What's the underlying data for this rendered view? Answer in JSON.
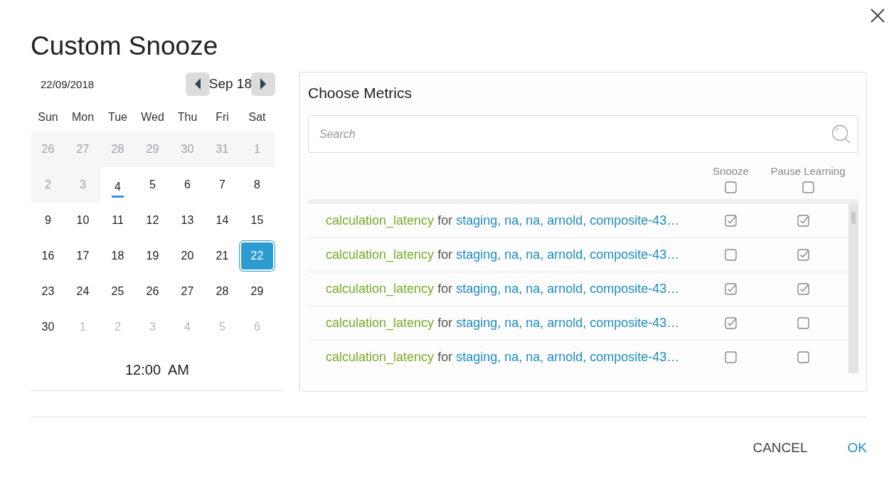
{
  "dialog": {
    "title": "Custom Snooze"
  },
  "calendar": {
    "date": "22/09/2018",
    "month": "Sep 18",
    "weekdays": [
      "Sun",
      "Mon",
      "Tue",
      "Wed",
      "Thu",
      "Fri",
      "Sat"
    ],
    "weeks": [
      [
        {
          "label": "26",
          "disabled": true,
          "today": false,
          "selected": false
        },
        {
          "label": "27",
          "disabled": true,
          "today": false,
          "selected": false
        },
        {
          "label": "28",
          "disabled": true,
          "today": false,
          "selected": false
        },
        {
          "label": "29",
          "disabled": true,
          "today": false,
          "selected": false
        },
        {
          "label": "30",
          "disabled": true,
          "today": false,
          "selected": false
        },
        {
          "label": "31",
          "disabled": true,
          "today": false,
          "selected": false
        },
        {
          "label": "1",
          "disabled": true,
          "today": false,
          "selected": false
        }
      ],
      [
        {
          "label": "2",
          "disabled": true,
          "today": false,
          "selected": false
        },
        {
          "label": "3",
          "disabled": true,
          "today": false,
          "selected": false
        },
        {
          "label": "4",
          "outside": false,
          "disabled": false,
          "today": true,
          "selected": false
        },
        {
          "label": "5",
          "outside": false,
          "disabled": false,
          "today": false,
          "selected": false
        },
        {
          "label": "6",
          "outside": false,
          "disabled": false,
          "today": false,
          "selected": false
        },
        {
          "label": "7",
          "outside": false,
          "disabled": false,
          "today": false,
          "selected": false
        },
        {
          "label": "8",
          "outside": false,
          "disabled": false,
          "today": false,
          "selected": false
        }
      ],
      [
        {
          "label": "9",
          "outside": false,
          "disabled": false,
          "today": false,
          "selected": false
        },
        {
          "label": "10",
          "outside": false,
          "disabled": false,
          "today": false,
          "selected": false
        },
        {
          "label": "11",
          "outside": false,
          "disabled": false,
          "today": false,
          "selected": false
        },
        {
          "label": "12",
          "outside": false,
          "disabled": false,
          "today": false,
          "selected": false
        },
        {
          "label": "13",
          "outside": false,
          "disabled": false,
          "today": false,
          "selected": false
        },
        {
          "label": "14",
          "outside": false,
          "disabled": false,
          "today": false,
          "selected": false
        },
        {
          "label": "15",
          "outside": false,
          "disabled": false,
          "today": false,
          "selected": false
        }
      ],
      [
        {
          "label": "16",
          "outside": false,
          "disabled": false,
          "today": false,
          "selected": false
        },
        {
          "label": "17",
          "outside": false,
          "disabled": false,
          "today": false,
          "selected": false
        },
        {
          "label": "18",
          "outside": false,
          "disabled": false,
          "today": false,
          "selected": false
        },
        {
          "label": "19",
          "outside": false,
          "disabled": false,
          "today": false,
          "selected": false
        },
        {
          "label": "20",
          "outside": false,
          "disabled": false,
          "today": false,
          "selected": false
        },
        {
          "label": "21",
          "outside": false,
          "disabled": false,
          "today": false,
          "selected": false
        },
        {
          "label": "22",
          "outside": false,
          "disabled": false,
          "today": false,
          "selected": true
        }
      ],
      [
        {
          "label": "23",
          "outside": false,
          "disabled": false,
          "today": false,
          "selected": false
        },
        {
          "label": "24",
          "outside": false,
          "disabled": false,
          "today": false,
          "selected": false
        },
        {
          "label": "25",
          "outside": false,
          "disabled": false,
          "today": false,
          "selected": false
        },
        {
          "label": "26",
          "outside": false,
          "disabled": false,
          "today": false,
          "selected": false
        },
        {
          "label": "27",
          "outside": false,
          "disabled": false,
          "today": false,
          "selected": false
        },
        {
          "label": "28",
          "outside": false,
          "disabled": false,
          "today": false,
          "selected": false
        },
        {
          "label": "29",
          "outside": false,
          "disabled": false,
          "today": false,
          "selected": false
        }
      ],
      [
        {
          "label": "30",
          "outside": false,
          "disabled": false,
          "today": false,
          "selected": false
        },
        {
          "label": "1",
          "outside": true,
          "disabled": false,
          "today": false,
          "selected": false
        },
        {
          "label": "2",
          "outside": true,
          "disabled": false,
          "today": false,
          "selected": false
        },
        {
          "label": "3",
          "outside": true,
          "disabled": false,
          "today": false,
          "selected": false
        },
        {
          "label": "4",
          "outside": true,
          "disabled": false,
          "today": false,
          "selected": false
        },
        {
          "label": "5",
          "outside": true,
          "disabled": false,
          "today": false,
          "selected": false
        },
        {
          "label": "6",
          "outside": true,
          "disabled": false,
          "today": false,
          "selected": false
        }
      ]
    ],
    "time": "12:00  AM"
  },
  "metrics": {
    "title": "Choose Metrics",
    "search": {
      "placeholder": "Search"
    },
    "columns": [
      {
        "label": "Snooze",
        "checked": false
      },
      {
        "label": "Pause Learning",
        "checked": false
      }
    ],
    "rows": [
      {
        "metric": "calculation_latency",
        "joiner": "for",
        "target": "staging, na, na, arnold, composite-43…",
        "snooze": true,
        "pause": true
      },
      {
        "metric": "calculation_latency",
        "joiner": "for",
        "target": "staging, na, na, arnold, composite-43…",
        "snooze": false,
        "pause": true
      },
      {
        "metric": "calculation_latency",
        "joiner": "for",
        "target": "staging, na, na, arnold, composite-43…",
        "snooze": true,
        "pause": true
      },
      {
        "metric": "calculation_latency",
        "joiner": "for",
        "target": "staging, na, na, arnold, composite-43…",
        "snooze": true,
        "pause": false
      },
      {
        "metric": "calculation_latency",
        "joiner": "for",
        "target": "staging, na, na, arnold, composite-43…",
        "snooze": false,
        "pause": false
      }
    ]
  },
  "buttons": [
    "CANCEL",
    "OK"
  ]
}
